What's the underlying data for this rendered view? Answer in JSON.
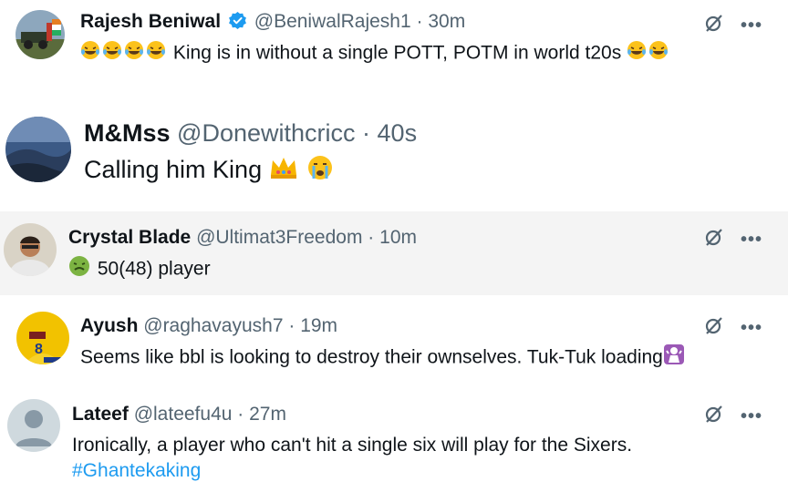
{
  "tweets": [
    {
      "name": "Rajesh Beniwal",
      "handle": "@BeniwalRajesh1",
      "time": "30m",
      "verified": true,
      "text": "King is in without a single POTT, POTM in world t20s",
      "leading_emoji": [
        "laughing-tears",
        "laughing-tears",
        "laughing-tears",
        "laughing-tears"
      ],
      "trailing_emoji": [
        "laughing-tears",
        "laughing-tears"
      ]
    },
    {
      "name": "M&Mss",
      "handle": "@Donewithcricc",
      "time": "40s",
      "text": "Calling him King",
      "trailing_emoji": [
        "crown",
        "crying"
      ]
    },
    {
      "name": "Crystal Blade",
      "handle": "@Ultimat3Freedom",
      "time": "10m",
      "text": "50(48) player",
      "leading_emoji": [
        "nauseated-face"
      ]
    },
    {
      "name": "Ayush",
      "handle": "@raghavayush7",
      "time": "19m",
      "text": "Seems like bbl is looking to destroy their ownselves. Tuk-Tuk loading",
      "trailing_emoji": [
        "woman-pouting-purple"
      ]
    },
    {
      "name": "Lateef",
      "handle": "@lateefu4u",
      "time": "27m",
      "text": "Ironically, a player who can't hit a single six will play for the Sixers.",
      "hashtag": "#Ghantekaking"
    }
  ],
  "separator": "·",
  "more_label": "•••",
  "colors": {
    "link": "#1d9bf0",
    "muted": "#536471",
    "verified": "#1d9bf0"
  }
}
